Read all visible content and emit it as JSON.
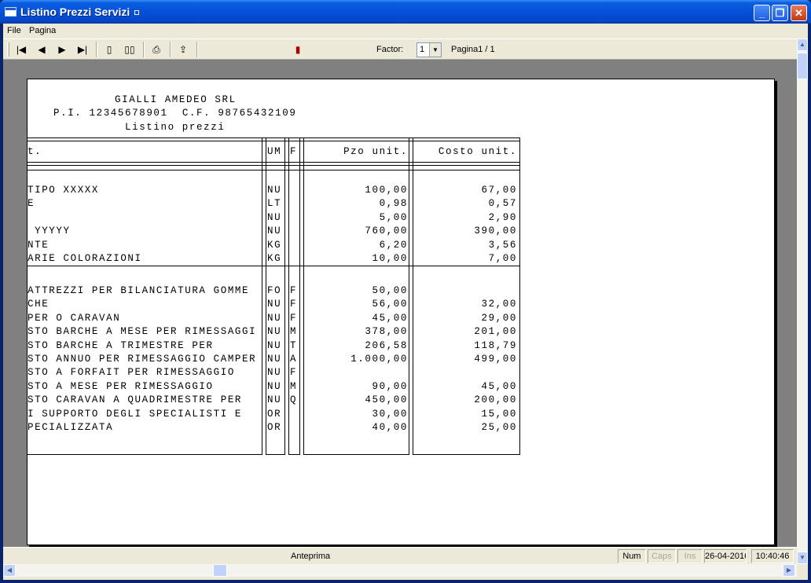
{
  "window": {
    "title": "Listino Prezzi Servizi",
    "controls": {
      "minimize": "_",
      "maximize": "❐",
      "close": "✕"
    }
  },
  "menu": {
    "file": "File",
    "pagina": "Pagina"
  },
  "toolbar": {
    "icons": [
      "first-page-icon",
      "prev-page-icon",
      "next-page-icon",
      "last-page-icon",
      "single-page-icon",
      "two-pages-icon",
      "print-icon",
      "export-icon",
      "exit-icon"
    ],
    "factor_label": "Factor:",
    "factor_value": "1",
    "page_indicator": "Pagina1 / 1"
  },
  "report": {
    "company": "GIALLI AMEDEO SRL",
    "tax_ids": "P.I. 12345678901  C.F. 98765432109",
    "title": "Listino prezzi",
    "columns": {
      "desc": "t.",
      "um": "UM",
      "f": "F",
      "price": "Pzo unit.",
      "cost": "Costo unit."
    },
    "group1": [
      {
        "desc": "TIPO XXXXX",
        "um": "NU",
        "f": "",
        "price": "100,00",
        "cost": "67,00"
      },
      {
        "desc": "E",
        "um": "LT",
        "f": "",
        "price": "0,98",
        "cost": "0,57"
      },
      {
        "desc": "",
        "um": "NU",
        "f": "",
        "price": "5,00",
        "cost": "2,90"
      },
      {
        "desc": " YYYYY",
        "um": "NU",
        "f": "",
        "price": "760,00",
        "cost": "390,00"
      },
      {
        "desc": "NTE",
        "um": "KG",
        "f": "",
        "price": "6,20",
        "cost": "3,56"
      },
      {
        "desc": "ARIE COLORAZIONI",
        "um": "KG",
        "f": "",
        "price": "10,00",
        "cost": "7,00"
      }
    ],
    "group2": [
      {
        "desc": "ATTREZZI PER BILANCIATURA GOMME",
        "um": "FO",
        "f": "F",
        "price": "50,00",
        "cost": ""
      },
      {
        "desc": "CHE",
        "um": "NU",
        "f": "F",
        "price": "56,00",
        "cost": "32,00"
      },
      {
        "desc": "PER O CARAVAN",
        "um": "NU",
        "f": "F",
        "price": "45,00",
        "cost": "29,00"
      },
      {
        "desc": "STO BARCHE A MESE PER RIMESSAGGI",
        "um": "NU",
        "f": "M",
        "price": "378,00",
        "cost": "201,00"
      },
      {
        "desc": "STO BARCHE A TRIMESTRE PER",
        "um": "NU",
        "f": "T",
        "price": "206,58",
        "cost": "118,79"
      },
      {
        "desc": "STO ANNUO PER RIMESSAGGIO CAMPER",
        "um": "NU",
        "f": "A",
        "price": "1.000,00",
        "cost": "499,00"
      },
      {
        "desc": "STO A FORFAIT PER RIMESSAGGIO",
        "um": "NU",
        "f": "F",
        "price": "",
        "cost": ""
      },
      {
        "desc": "STO A MESE PER RIMESSAGGIO",
        "um": "NU",
        "f": "M",
        "price": "90,00",
        "cost": "45,00"
      },
      {
        "desc": "STO CARAVAN A QUADRIMESTRE PER",
        "um": "NU",
        "f": "Q",
        "price": "450,00",
        "cost": "200,00"
      },
      {
        "desc": "I SUPPORTO DEGLI SPECIALISTI E",
        "um": "OR",
        "f": "",
        "price": "30,00",
        "cost": "15,00"
      },
      {
        "desc": "PECIALIZZATA",
        "um": "OR",
        "f": "",
        "price": "40,00",
        "cost": "25,00"
      }
    ]
  },
  "status": {
    "main": "Anteprima",
    "num": "Num",
    "caps": "Caps",
    "ins": "Ins",
    "date": "26-04-2016",
    "time": "10:40:46"
  }
}
